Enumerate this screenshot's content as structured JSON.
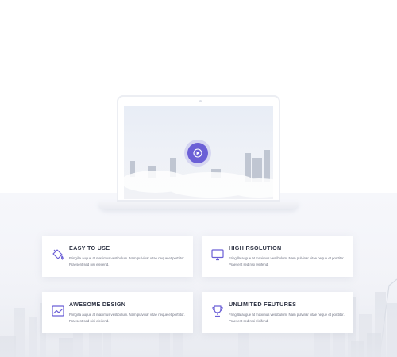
{
  "hero": {
    "play_icon": "play-icon"
  },
  "features": [
    {
      "title": "EASY TO USE",
      "icon": "paint-bucket-icon",
      "text": "Fringilla augue at maximus vestibulum. Nam pulvinar vitae neque et porttitor. Praesent sed nisi eleifend."
    },
    {
      "title": "HIGH RSOLUTION",
      "icon": "monitor-icon",
      "text": "Fringilla augue at maximus vestibulum. Nam pulvinar vitae neque et porttitor. Praesent sed nisi eleifend."
    },
    {
      "title": "AWESOME DESIGN",
      "icon": "chart-image-icon",
      "text": "Fringilla augue at maximus vestibulum. Nam pulvinar vitae neque et porttitor. Praesent sed nisi eleifend."
    },
    {
      "title": "UNLIMITED FEUTURES",
      "icon": "trophy-icon",
      "text": "Fringilla augue at maximus vestibulum. Nam pulvinar vitae neque et porttitor. Praesent sed nisi eleifend."
    }
  ],
  "colors": {
    "accent": "#6b5fd6",
    "title": "#2f3445",
    "text": "#6c7080",
    "background": "#f3f4f8"
  }
}
